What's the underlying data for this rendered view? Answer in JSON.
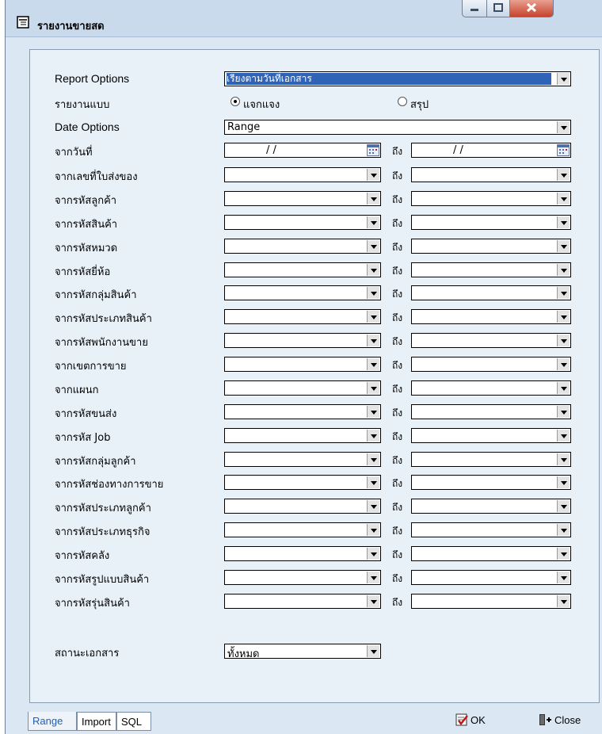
{
  "window": {
    "title": "รายงานขายสด"
  },
  "form": {
    "report_options": {
      "label": "Report Options",
      "value": "เรียงตามวันที่เอกสาร"
    },
    "report_type": {
      "label": "รายงานแบบ",
      "option_detail": "แจกแจง",
      "option_summary": "สรุป",
      "selected": "แจกแจง"
    },
    "date_options": {
      "label": "Date Options",
      "value": "Range"
    },
    "date_range": {
      "label": "จากวันที่",
      "from": "/ /",
      "to": "/ /"
    },
    "to_label": "ถึง",
    "ranges": [
      "จากเลขที่ใบส่งของ",
      "จากรหัสลูกค้า",
      "จากรหัสสินค้า",
      "จากรหัสหมวด",
      "จากรหัสยี่ห้อ",
      "จากรหัสกลุ่มสินค้า",
      "จากรหัสประเภทสินค้า",
      "จากรหัสพนักงานขาย",
      "จากเขตการขาย",
      "จากแผนก",
      "จากรหัสขนส่ง",
      "จากรหัส Job",
      "จากรหัสกลุ่มลูกค้า",
      "จากรหัสช่องทางการขาย",
      "จากรหัสประเภทลูกค้า",
      "จากรหัสประเภทธุรกิจ",
      "จากรหัสคลัง",
      "จากรหัสรูปแบบสินค้า",
      "จากรหัสรุ่นสินค้า"
    ],
    "doc_status": {
      "label": "สถานะเอกสาร",
      "value": "ทั้งหมด"
    }
  },
  "tabs": [
    "Range",
    "Import",
    "SQL"
  ],
  "buttons": {
    "ok": "OK",
    "close": "Close"
  }
}
